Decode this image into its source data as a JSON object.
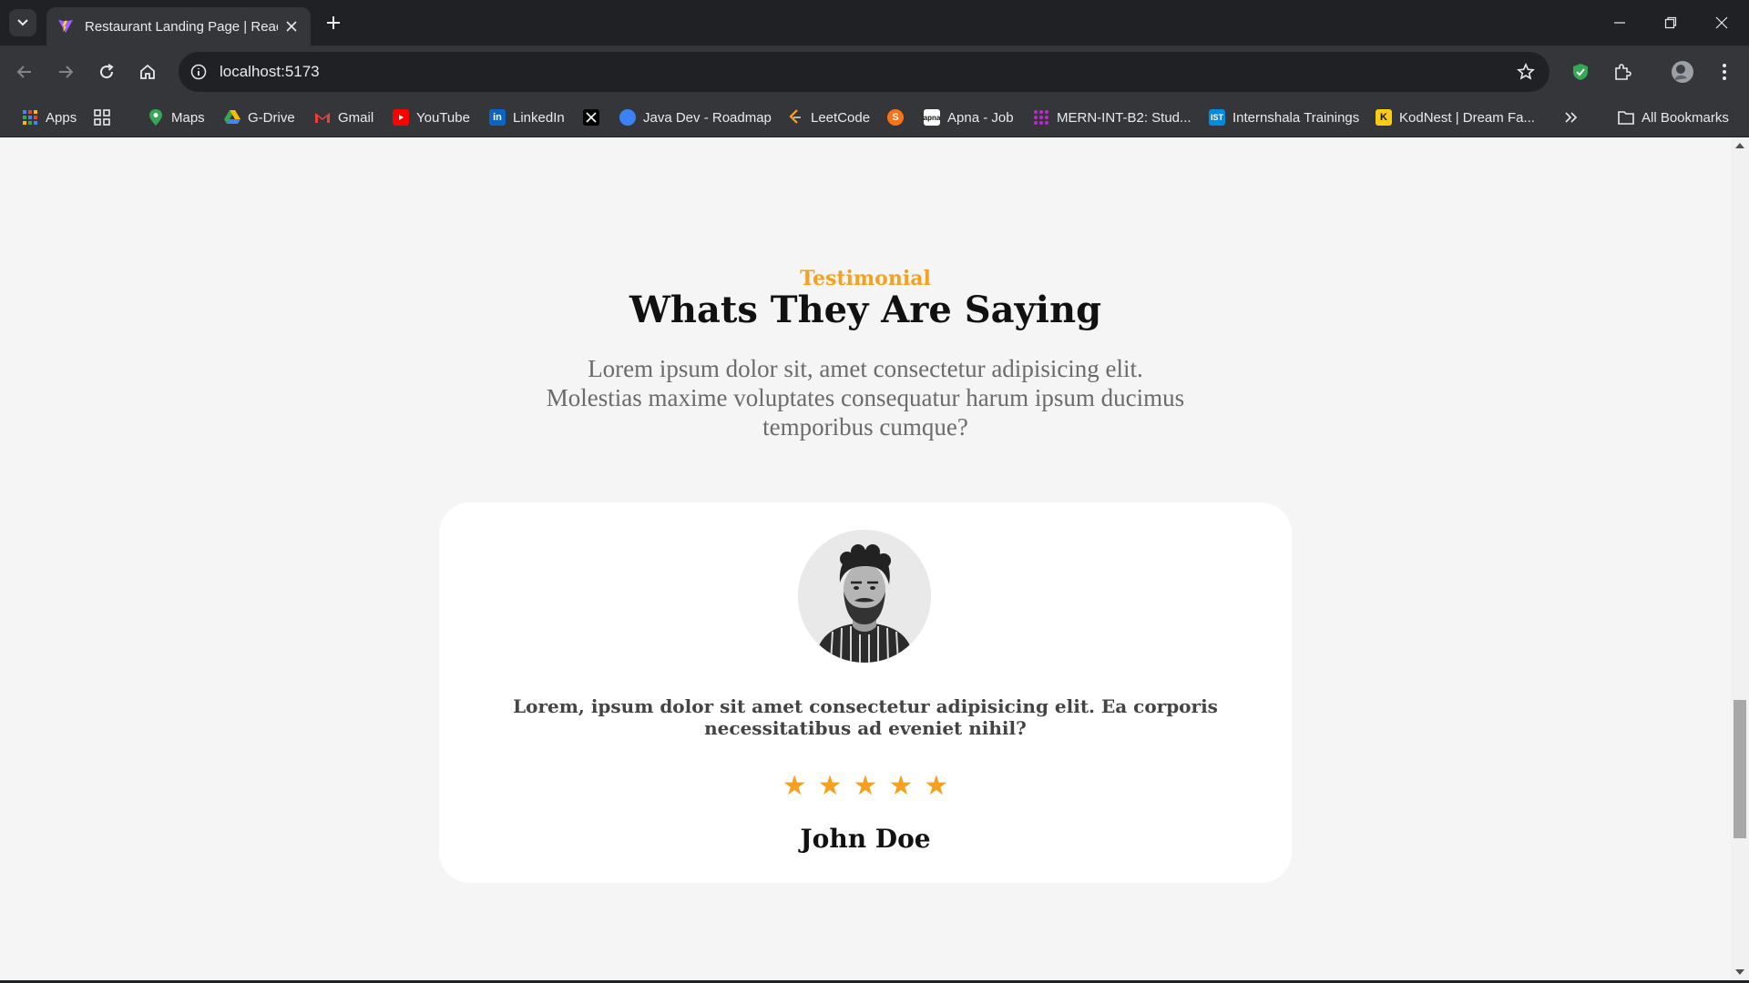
{
  "browser": {
    "tab_title": "Restaurant Landing Page | React",
    "url": "localhost:5173",
    "bookmarks": [
      {
        "label": "Apps",
        "icon": "apps-grid-icon",
        "color": "#4285f4"
      },
      {
        "label": "",
        "icon": "tab-groups-icon",
        "color": "#e8eaed"
      },
      {
        "label": "Maps",
        "icon": "maps-icon",
        "color": "#34a853"
      },
      {
        "label": "G-Drive",
        "icon": "drive-icon",
        "color": "#fbbc04"
      },
      {
        "label": "Gmail",
        "icon": "gmail-icon",
        "color": "#ea4335"
      },
      {
        "label": "YouTube",
        "icon": "youtube-icon",
        "color": "#ff0000"
      },
      {
        "label": "LinkedIn",
        "icon": "linkedin-icon",
        "color": "#0a66c2"
      },
      {
        "label": "",
        "icon": "x-icon",
        "color": "#000000"
      },
      {
        "label": "Java Dev - Roadmap",
        "icon": "roadmap-icon",
        "color": "#3b82f6"
      },
      {
        "label": "LeetCode",
        "icon": "leetcode-icon",
        "color": "#ffa116"
      },
      {
        "label": "",
        "icon": "s-icon",
        "color": "#f97316"
      },
      {
        "label": "Apna - Job",
        "icon": "apna-icon",
        "color": "#ffffff"
      },
      {
        "label": "MERN-INT-B2: Stud...",
        "icon": "mern-icon",
        "color": "#c026d3"
      },
      {
        "label": "Internshala Trainings",
        "icon": "internshala-icon",
        "color": "#008bdc"
      },
      {
        "label": "KodNest | Dream Fa...",
        "icon": "kodnest-icon",
        "color": "#facc15"
      }
    ],
    "all_bookmarks_label": "All Bookmarks"
  },
  "page": {
    "subtitle": "Testimonial",
    "heading": "Whats They Are Saying",
    "lead": "Lorem ipsum dolor sit, amet consectetur adipisicing elit. Molestias maxime voluptates consequatur harum ipsum ducimus temporibus cumque?",
    "testimonial": {
      "quote": "Lorem, ipsum dolor sit amet consectetur adipisicing elit. Ea corporis necessitatibus ad eveniet nihil?",
      "rating": 5,
      "name": "John Doe"
    },
    "accent_color": "#f5a01f"
  }
}
